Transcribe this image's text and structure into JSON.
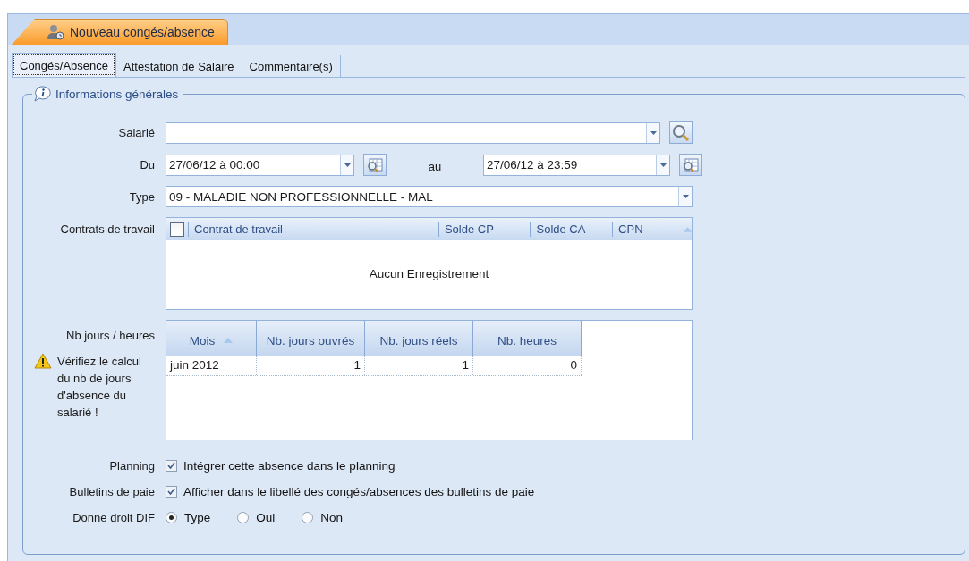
{
  "header_tab": {
    "label": "Nouveau congés/absence"
  },
  "tabs": [
    {
      "label": "Congés/Absence",
      "selected": true
    },
    {
      "label": "Attestation de Salaire",
      "selected": false
    },
    {
      "label": "Commentaire(s)",
      "selected": false
    }
  ],
  "group": {
    "title": "Informations générales"
  },
  "employee": {
    "label": "Salarié"
  },
  "period": {
    "label": "Du",
    "start": "27/06/12 à 00:00",
    "separator": "au",
    "end": "27/06/12 à 23:59"
  },
  "type": {
    "label": "Type",
    "value": "09 - MALADIE NON PROFESSIONNELLE - MAL"
  },
  "contracts": {
    "label": "Contrats de travail",
    "select_all_checked": false,
    "columns": [
      "Contrat de travail",
      "Solde CP",
      "Solde CA",
      "CPN"
    ],
    "empty_message": "Aucun Enregistrement"
  },
  "days": {
    "label": "Nb jours / heures",
    "warning": "Vérifiez le calcul du nb de jours d'absence du salarié !",
    "columns": [
      "Mois",
      "Nb. jours ouvrés",
      "Nb. jours réels",
      "Nb. heures"
    ],
    "rows": [
      [
        "juin 2012",
        "1",
        "1",
        "0"
      ]
    ]
  },
  "options": [
    {
      "label": "Planning",
      "text": "Intégrer cette absence dans le planning",
      "checked": true
    },
    {
      "label": "Bulletins de paie",
      "text": "Afficher dans le libellé des congés/absences des bulletins de paie",
      "checked": true
    }
  ],
  "dif": {
    "label": "Donne droit DIF",
    "choices": [
      {
        "label": "Type",
        "selected": true
      },
      {
        "label": "Oui",
        "selected": false
      },
      {
        "label": "Non",
        "selected": false
      }
    ]
  }
}
